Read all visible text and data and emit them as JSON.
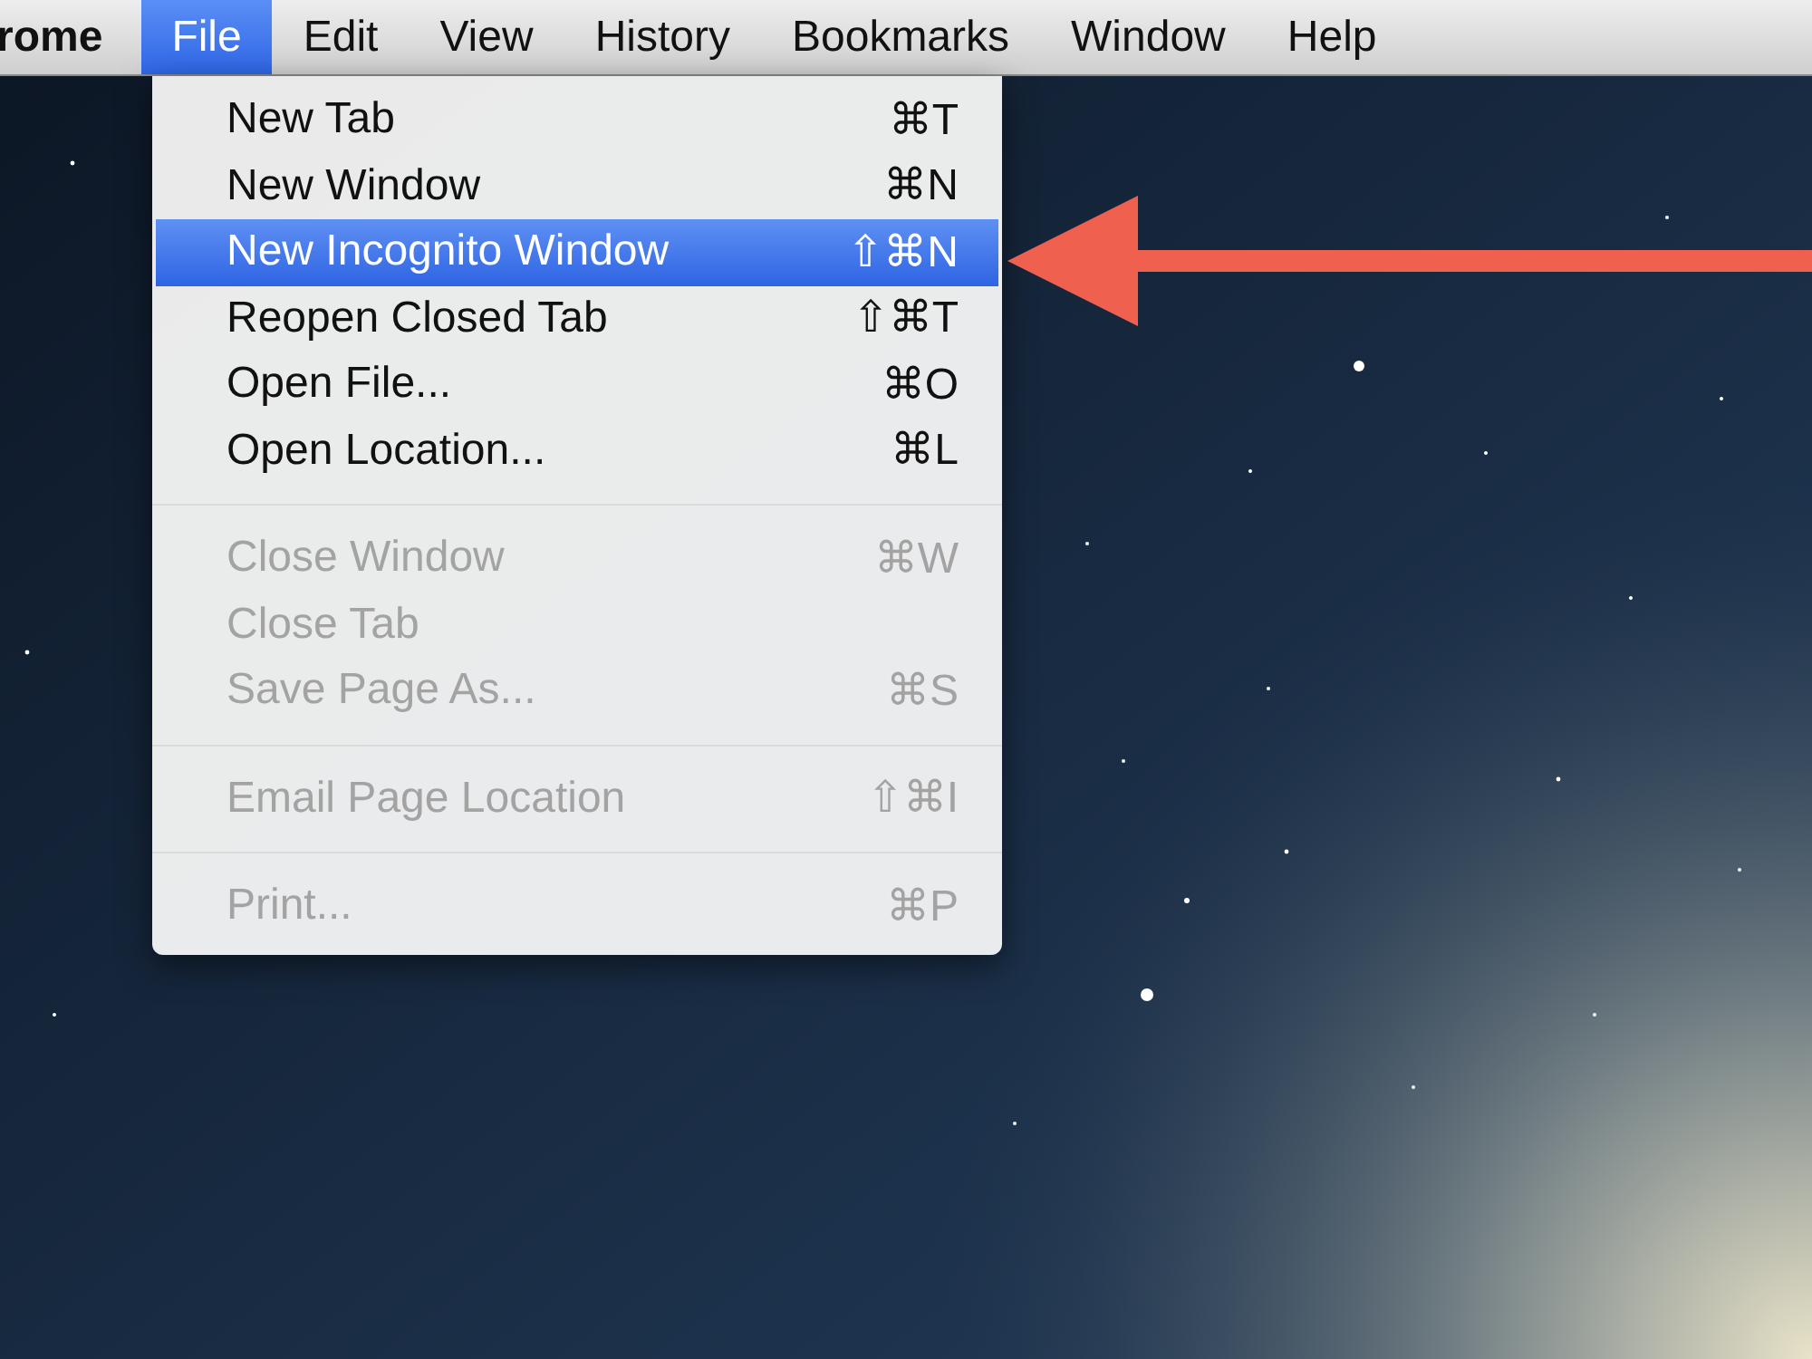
{
  "menu_bar": {
    "items": [
      {
        "kind": "app",
        "label": "rome",
        "selected": false
      },
      {
        "kind": "menu",
        "label": "File",
        "selected": true
      },
      {
        "kind": "menu",
        "label": "Edit",
        "selected": false
      },
      {
        "kind": "menu",
        "label": "View",
        "selected": false
      },
      {
        "kind": "menu",
        "label": "History",
        "selected": false
      },
      {
        "kind": "menu",
        "label": "Bookmarks",
        "selected": false
      },
      {
        "kind": "menu",
        "label": "Window",
        "selected": false
      },
      {
        "kind": "menu",
        "label": "Help",
        "selected": false
      }
    ]
  },
  "file_menu": {
    "items": [
      {
        "kind": "item",
        "label": "New Tab",
        "shortcut": "⌘T",
        "disabled": false,
        "selected": false
      },
      {
        "kind": "item",
        "label": "New Window",
        "shortcut": "⌘N",
        "disabled": false,
        "selected": false
      },
      {
        "kind": "item",
        "label": "New Incognito Window",
        "shortcut": "⇧⌘N",
        "disabled": false,
        "selected": true
      },
      {
        "kind": "item",
        "label": "Reopen Closed Tab",
        "shortcut": "⇧⌘T",
        "disabled": false,
        "selected": false
      },
      {
        "kind": "item",
        "label": "Open File...",
        "shortcut": "⌘O",
        "disabled": false,
        "selected": false
      },
      {
        "kind": "item",
        "label": "Open Location...",
        "shortcut": "⌘L",
        "disabled": false,
        "selected": false
      },
      {
        "kind": "separator"
      },
      {
        "kind": "item",
        "label": "Close Window",
        "shortcut": "⌘W",
        "disabled": true,
        "selected": false
      },
      {
        "kind": "item",
        "label": "Close Tab",
        "disabled": true,
        "selected": false
      },
      {
        "kind": "item",
        "label": "Save Page As...",
        "shortcut": "⌘S",
        "disabled": true,
        "selected": false
      },
      {
        "kind": "separator"
      },
      {
        "kind": "item",
        "label": "Email Page Location",
        "shortcut": "⇧⌘I",
        "disabled": true,
        "selected": false
      },
      {
        "kind": "separator"
      },
      {
        "kind": "item",
        "label": "Print...",
        "shortcut": "⌘P",
        "disabled": true,
        "selected": false
      }
    ]
  }
}
